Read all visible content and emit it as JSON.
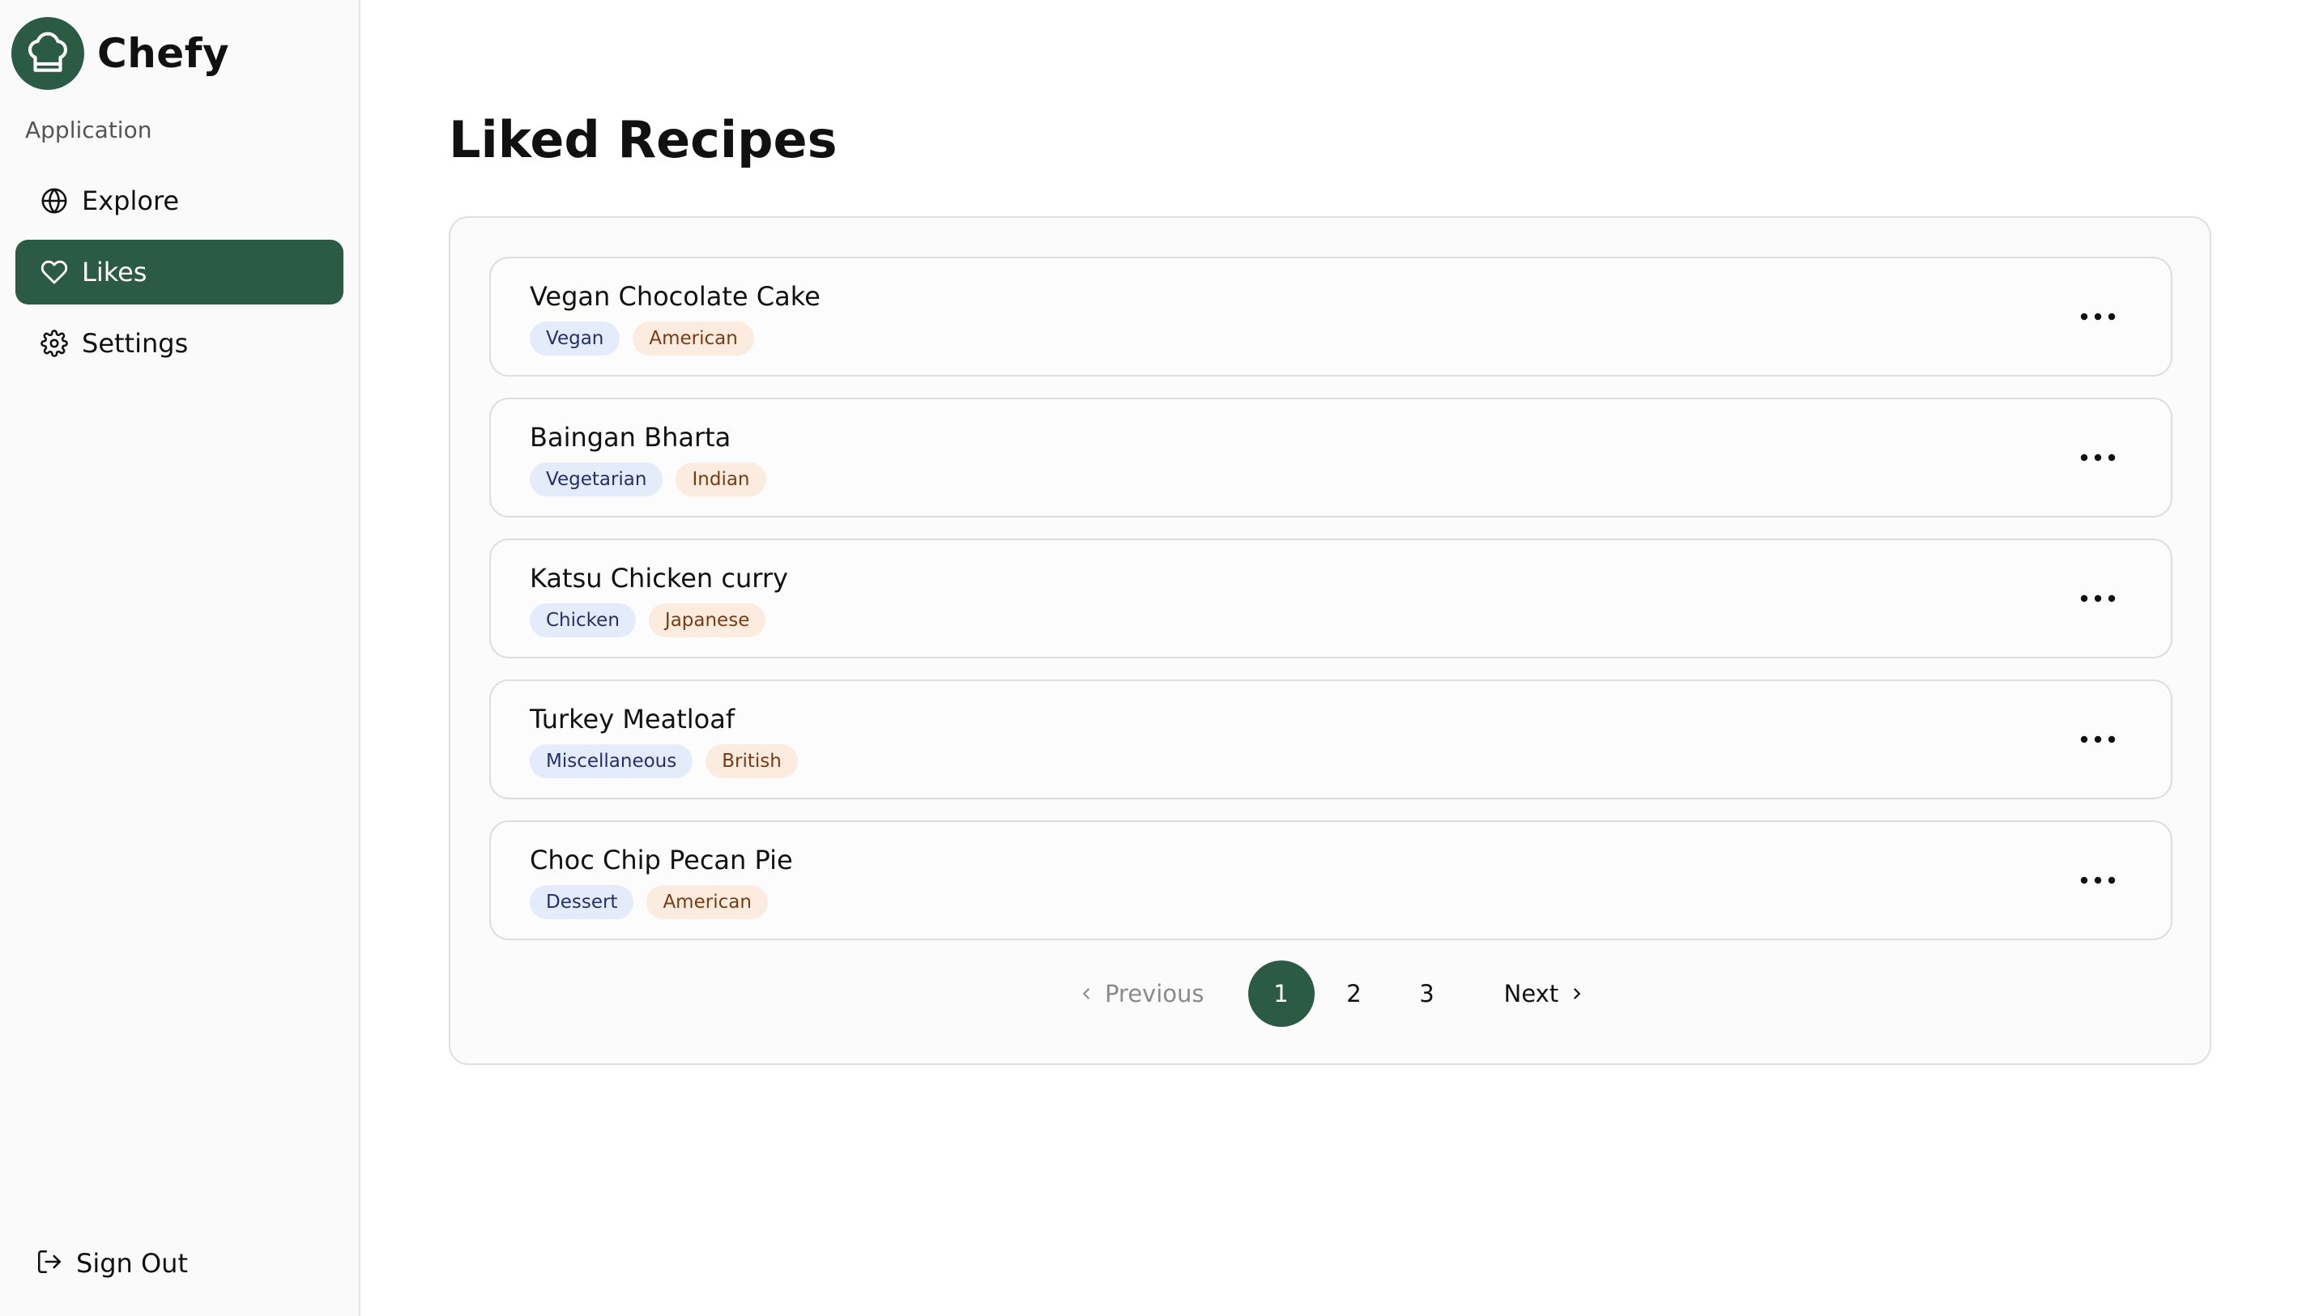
{
  "brand": {
    "name": "Chefy",
    "logo_icon": "chef-hat-icon",
    "accent_color": "#2b5a45"
  },
  "sidebar": {
    "section_label": "Application",
    "items": [
      {
        "label": "Explore",
        "icon": "globe-icon",
        "active": false
      },
      {
        "label": "Likes",
        "icon": "heart-icon",
        "active": true
      },
      {
        "label": "Settings",
        "icon": "gear-icon",
        "active": false
      }
    ],
    "sign_out": {
      "label": "Sign Out",
      "icon": "sign-out-icon"
    }
  },
  "main": {
    "title": "Liked Recipes",
    "recipes": [
      {
        "name": "Vegan Chocolate Cake",
        "category": "Vegan",
        "cuisine": "American"
      },
      {
        "name": "Baingan Bharta",
        "category": "Vegetarian",
        "cuisine": "Indian"
      },
      {
        "name": "Katsu Chicken curry",
        "category": "Chicken",
        "cuisine": "Japanese"
      },
      {
        "name": "Turkey Meatloaf",
        "category": "Miscellaneous",
        "cuisine": "British"
      },
      {
        "name": "Choc Chip Pecan Pie",
        "category": "Dessert",
        "cuisine": "American"
      }
    ],
    "pagination": {
      "previous_label": "Previous",
      "next_label": "Next",
      "pages": [
        "1",
        "2",
        "3"
      ],
      "current_page": "1"
    }
  },
  "colors": {
    "category_tag_bg": "#e4ebfa",
    "cuisine_tag_bg": "#fcecdf"
  }
}
